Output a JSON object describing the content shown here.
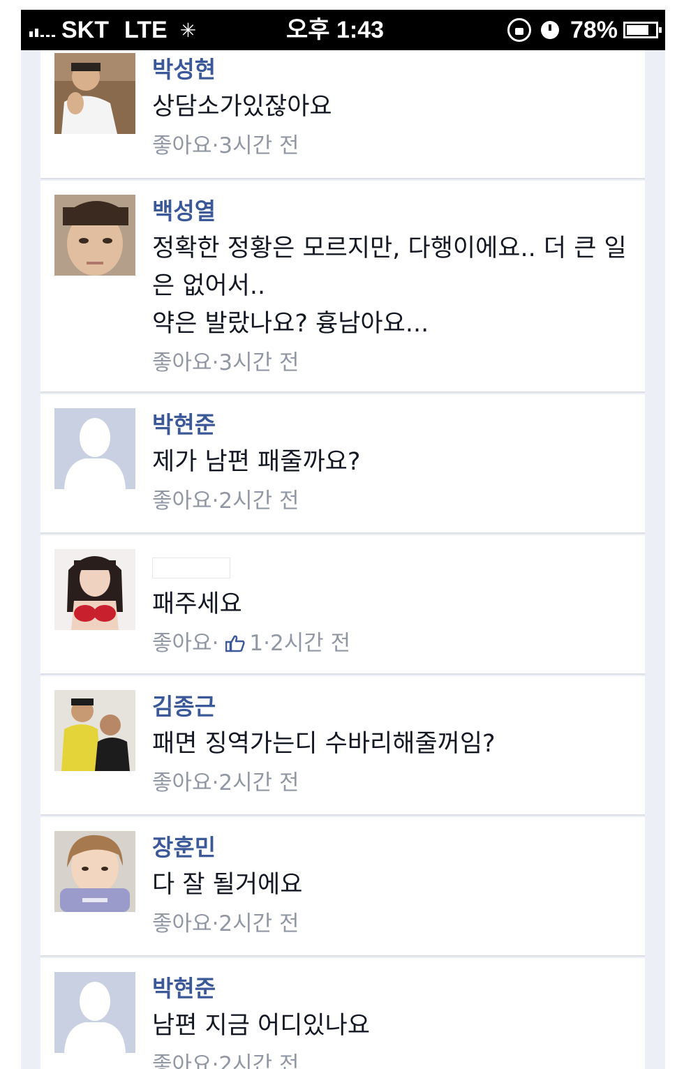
{
  "statusbar": {
    "carrier": "SKT",
    "network": "LTE",
    "time": "오후 1:43",
    "battery": "78%",
    "battery_level": 0.78
  },
  "comments": [
    {
      "author": "박성현",
      "text": "상담소가있잖아요",
      "like_label": "좋아요",
      "separator": " · ",
      "time": "3시간 전",
      "avatar": "photo"
    },
    {
      "author": "백성열",
      "text": "정확한 정황은 모르지만, 다행이에요.. 더 큰 일은 없어서..\n약은 발랐나요? 흉남아요...",
      "like_label": "좋아요",
      "separator": " · ",
      "time": "3시간 전",
      "avatar": "photo"
    },
    {
      "author": "박현준",
      "text": "제가 남편 패줄까요?",
      "like_label": "좋아요",
      "separator": " · ",
      "time": "2시간 전",
      "avatar": "default"
    },
    {
      "author": "",
      "text": "패주세요",
      "like_label": "좋아요",
      "separator": " · ",
      "like_count": "1",
      "time": "2시간 전",
      "avatar": "photo"
    },
    {
      "author": "김종근",
      "text": "패면 징역가는디 수바리해줄꺼임?",
      "like_label": "좋아요",
      "separator": " · ",
      "time": "2시간 전",
      "avatar": "photo"
    },
    {
      "author": "장훈민",
      "text": "다 잘 될거에요",
      "like_label": "좋아요",
      "separator": " · ",
      "time": "2시간 전",
      "avatar": "photo"
    },
    {
      "author": "박현준",
      "text": "남편 지금 어디있나요",
      "like_label": "좋아요",
      "separator": " · ",
      "time": "2시간 전",
      "avatar": "default"
    }
  ],
  "icons": {
    "like": "thumbs-up-icon",
    "orientation_lock": "orientation-lock-icon",
    "alarm": "clock-icon",
    "battery": "battery-icon",
    "activity": "spinner-icon"
  },
  "colors": {
    "author": "#3b5998",
    "meta": "#9197a3",
    "background": "#eceff5",
    "default_avatar": "#c9d0e2"
  }
}
